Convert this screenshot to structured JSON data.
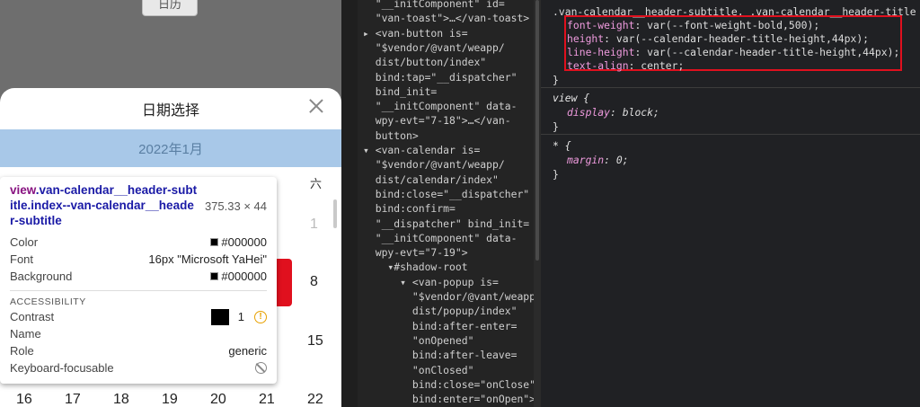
{
  "preview": {
    "top_button": "日历",
    "calendar": {
      "title": "日期选择",
      "month": "2022年1月",
      "weekday_sat": "六",
      "days_visible": [
        "1",
        "8",
        "15"
      ],
      "bottom_row": [
        "16",
        "17",
        "18",
        "19",
        "20",
        "21",
        "22"
      ]
    }
  },
  "tooltip": {
    "selector_tag": "view",
    "selector_class": ".van-calendar__header-subtitle.index--van-calendar__header-subtitle",
    "size": "375.33 × 44",
    "rows": [
      {
        "label": "Color",
        "value": "#000000"
      },
      {
        "label": "Font",
        "value": "16px \"Microsoft YaHei\""
      },
      {
        "label": "Background",
        "value": "#000000"
      }
    ],
    "accessibility_header": "ACCESSIBILITY",
    "contrast_label": "Contrast",
    "contrast_value": "1",
    "name_label": "Name",
    "role_label": "Role",
    "role_value": "generic",
    "focusable_label": "Keyboard-focusable"
  },
  "elements": {
    "lines": [
      {
        "t": "  \"__initComponent\" id="
      },
      {
        "t": "  \"van-toast\">…</van-toast>"
      },
      {
        "t": "▸ <van-button is="
      },
      {
        "t": "  \"$vendor/@vant/weapp/"
      },
      {
        "t": "  dist/button/index\""
      },
      {
        "t": "  bind:tap=\"__dispatcher\""
      },
      {
        "t": "  bind_init="
      },
      {
        "t": "  \"__initComponent\" data-"
      },
      {
        "t": "  wpy-evt=\"7-18\">…</van-"
      },
      {
        "t": "  button>"
      },
      {
        "t": "▾ <van-calendar is="
      },
      {
        "t": "  \"$vendor/@vant/weapp/"
      },
      {
        "t": "  dist/calendar/index\""
      },
      {
        "t": "  bind:close=\"__dispatcher\""
      },
      {
        "t": "  bind:confirm="
      },
      {
        "t": "  \"__dispatcher\" bind_init="
      },
      {
        "t": "  \"__initComponent\" data-"
      },
      {
        "t": "  wpy-evt=\"7-19\">"
      },
      {
        "t": "    ▾#shadow-root"
      },
      {
        "t": "      ▾ <van-popup is="
      },
      {
        "t": "        \"$vendor/@vant/weapp/"
      },
      {
        "t": "        dist/popup/index\""
      },
      {
        "t": "        bind:after-enter="
      },
      {
        "t": "        \"onOpened\""
      },
      {
        "t": "        bind:after-leave="
      },
      {
        "t": "        \"onClosed\""
      },
      {
        "t": "        bind:close=\"onClose\""
      },
      {
        "t": "        bind:enter=\"onOpen\">"
      }
    ]
  },
  "styles": {
    "rule1_selector": ".van-calendar__header-subtitle, .van-calendar__header-title {",
    "rule1_props": [
      {
        "p": "font-weight",
        "v": "var(--font-weight-bold,500);"
      },
      {
        "p": "height",
        "v": "var(--calendar-header-title-height,44px);"
      },
      {
        "p": "line-height",
        "v": "var(--calendar-header-title-height,44px);"
      },
      {
        "p": "text-align",
        "v": "center;"
      }
    ],
    "rule2_selector": "view {",
    "rule2_prop": {
      "p": "display",
      "v": "block;"
    },
    "rule3_selector": "* {",
    "rule3_prop": {
      "p": "margin",
      "v": "0;"
    },
    "close_brace": "}"
  }
}
